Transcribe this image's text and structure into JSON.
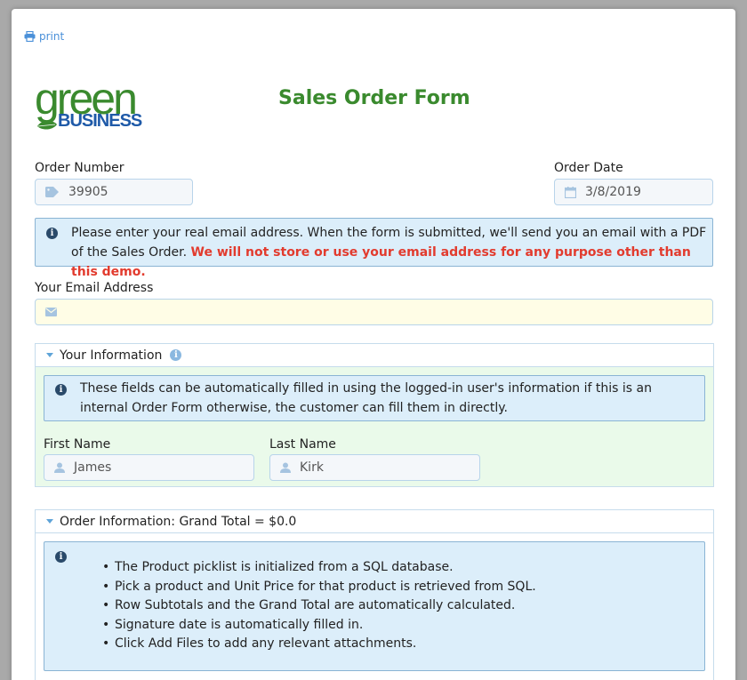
{
  "print_label": "print",
  "logo": {
    "word1": "green",
    "word2": "BUSINESS"
  },
  "title": "Sales Order Form",
  "order_number": {
    "label": "Order Number",
    "value": "39905",
    "icon": "tag-icon"
  },
  "order_date": {
    "label": "Order Date",
    "value": "3/8/2019",
    "icon": "calendar-icon"
  },
  "email_notice": {
    "text": "Please enter your real email address. When the form is submitted, we'll send you an email with a PDF of the Sales Order.",
    "warning": "We will not store or use your email address for any purpose other than this demo."
  },
  "email": {
    "label": "Your Email Address",
    "value": "",
    "icon": "envelope-icon"
  },
  "your_info": {
    "header": "Your Information",
    "notice": "These fields can be automatically filled in using the logged-in user's information if this is an internal Order Form otherwise, the customer can fill them in directly.",
    "first_name": {
      "label": "First Name",
      "value": "James"
    },
    "last_name": {
      "label": "Last Name",
      "value": "Kirk"
    }
  },
  "order_info": {
    "header": "Order Information: Grand Total = $0.0",
    "bullets": [
      "The Product picklist is initialized from a SQL database.",
      "Pick a product and Unit Price for that product is retrieved from SQL.",
      "Row Subtotals and the Grand Total are automatically calculated.",
      "Signature date is automatically filled in.",
      "Click Add Files to add any relevant attachments."
    ]
  },
  "colors": {
    "brand_green": "#3a8a2e",
    "brand_blue": "#1f5aa8",
    "info_bg": "#dceefa",
    "warning_red": "#e23b2e",
    "section_green_bg": "#eafaea",
    "email_field_bg": "#fffde6"
  }
}
